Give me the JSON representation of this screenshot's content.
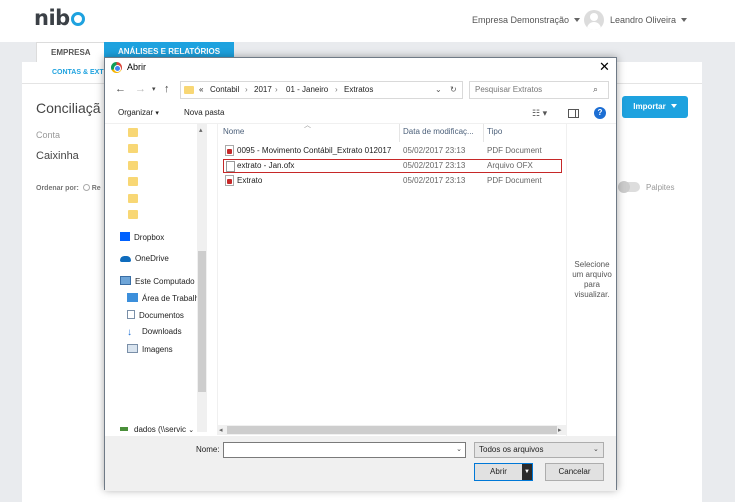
{
  "app": {
    "logo": "nib",
    "company": "Empresa Demonstração",
    "user": "Leandro Oliveira",
    "tabs": [
      "EMPRESA",
      "ANÁLISES E RELATÓRIOS"
    ],
    "subnav": "CONTAS & EXT",
    "page_title": "Conciliaçã",
    "conta_label": "Conta",
    "conta_value": "Caixinha",
    "ordenar": "Ordenar por:",
    "ordenar_opt": "Re",
    "import_btn": "Importar",
    "palpites": "Palpites"
  },
  "dialog": {
    "title": "Abrir",
    "breadcrumb": [
      "«",
      "Contabil",
      "2017",
      "01 - Janeiro",
      "Extratos"
    ],
    "search_placeholder": "Pesquisar Extratos",
    "toolbar": {
      "organize": "Organizar",
      "new_folder": "Nova pasta"
    },
    "nav": {
      "dropbox": "Dropbox",
      "onedrive": "OneDrive",
      "computer": "Este Computado",
      "desktop": "Área de Trabalh",
      "documents": "Documentos",
      "downloads": "Downloads",
      "images": "Imagens",
      "network_drive": "dados (\\\\servic"
    },
    "columns": {
      "name": "Nome",
      "date": "Data de modificaç...",
      "type": "Tipo"
    },
    "files": [
      {
        "name": "0095 - Movimento Contábil_Extrato 012017",
        "date": "05/02/2017 23:13",
        "type": "PDF Document",
        "icon": "pdf-icon"
      },
      {
        "name": "extrato - Jan.ofx",
        "date": "05/02/2017 23:13",
        "type": "Arquivo OFX",
        "icon": "document-icon",
        "selected": true
      },
      {
        "name": "Extrato",
        "date": "05/02/2017 23:13",
        "type": "PDF Document",
        "icon": "pdf-icon"
      }
    ],
    "preview_text": [
      "Selecione",
      "um arquivo",
      "para",
      "visualizar."
    ],
    "name_label": "Nome:",
    "name_value": "",
    "file_type": "Todos os arquivos",
    "open_btn": "Abrir",
    "cancel_btn": "Cancelar"
  },
  "colors": {
    "accent": "#1ea2df",
    "selection_border": "#c62828",
    "folder": "#f8d775"
  }
}
